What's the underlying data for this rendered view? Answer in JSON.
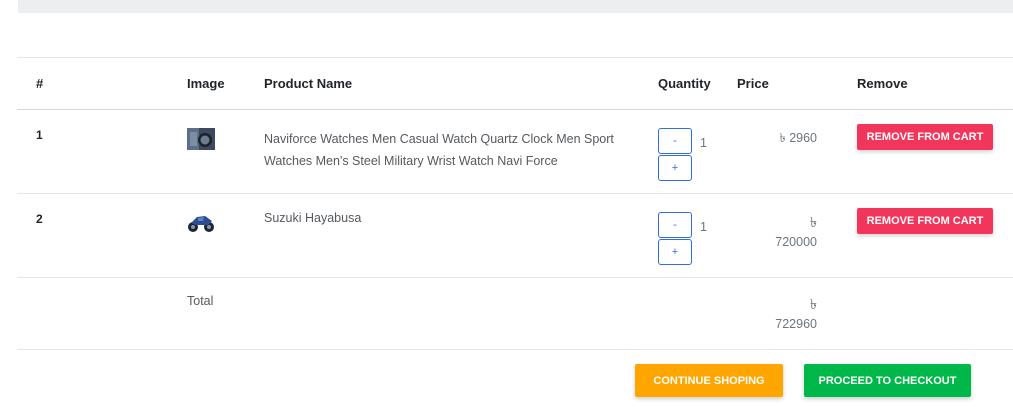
{
  "table": {
    "headers": {
      "index": "#",
      "image": "Image",
      "name": "Product Name",
      "quantity": "Quantity",
      "price": "Price",
      "remove": "Remove"
    },
    "rows": [
      {
        "index": "1",
        "image_icon": "watch-thumbnail",
        "name": "Naviforce Watches Men Casual Watch Quartz Clock Men Sport Watches Men's Steel Military Wrist Watch Navi Force",
        "minus_label": "-",
        "quantity": "1",
        "plus_label": "+",
        "currency": "৳",
        "price": "2960",
        "remove_label": "Remove from cart"
      },
      {
        "index": "2",
        "image_icon": "motorcycle-thumbnail",
        "name": "Suzuki Hayabusa",
        "minus_label": "-",
        "quantity": "1",
        "plus_label": "+",
        "currency": "৳",
        "price": "720000",
        "remove_label": "Remove from cart"
      }
    ],
    "total": {
      "label": "Total",
      "currency": "৳",
      "amount": "722960"
    }
  },
  "actions": {
    "continue_label": "Continue shoping",
    "checkout_label": "Proceed to checkout"
  },
  "colors": {
    "remove": "#f2355a",
    "continue": "#ffa500",
    "checkout": "#00b74a",
    "qty_border": "#2d6fe0"
  }
}
